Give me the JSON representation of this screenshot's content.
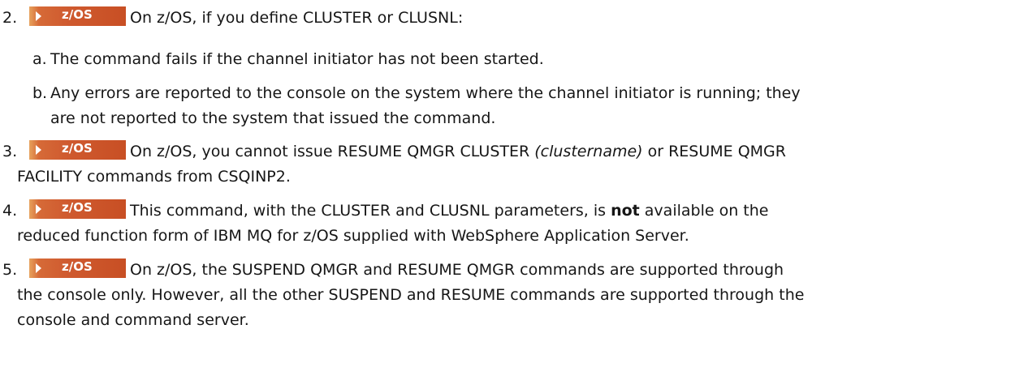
{
  "badge_label": "z/OS",
  "items": [
    {
      "number": "2.",
      "text": "On z/OS, if you define CLUSTER or CLUSNL:",
      "subitems": [
        {
          "letter": "a.",
          "text": "The command fails if the channel initiator has not been started."
        },
        {
          "letter": "b.",
          "line1": "Any errors are reported to the console on the system where the channel initiator is running; they",
          "line2": "are not reported to the system that issued the command."
        }
      ]
    },
    {
      "number": "3.",
      "line1_before": "On z/OS, you cannot issue RESUME QMGR CLUSTER ",
      "line1_italic": "(clustername)",
      "line1_after": " or RESUME QMGR",
      "line2": "FACILITY commands from CSQINP2."
    },
    {
      "number": "4.",
      "line1_before": "This command, with the CLUSTER and CLUSNL parameters, is ",
      "line1_bold": "not",
      "line1_after": " available on the",
      "line2": "reduced function form of IBM MQ for z/OS supplied with WebSphere Application Server."
    },
    {
      "number": "5.",
      "line1": "On z/OS, the SUSPEND QMGR and RESUME QMGR commands are supported through",
      "line2": "the console only. However, all the other SUSPEND and RESUME commands are supported through the",
      "line3": "console and command server."
    }
  ]
}
